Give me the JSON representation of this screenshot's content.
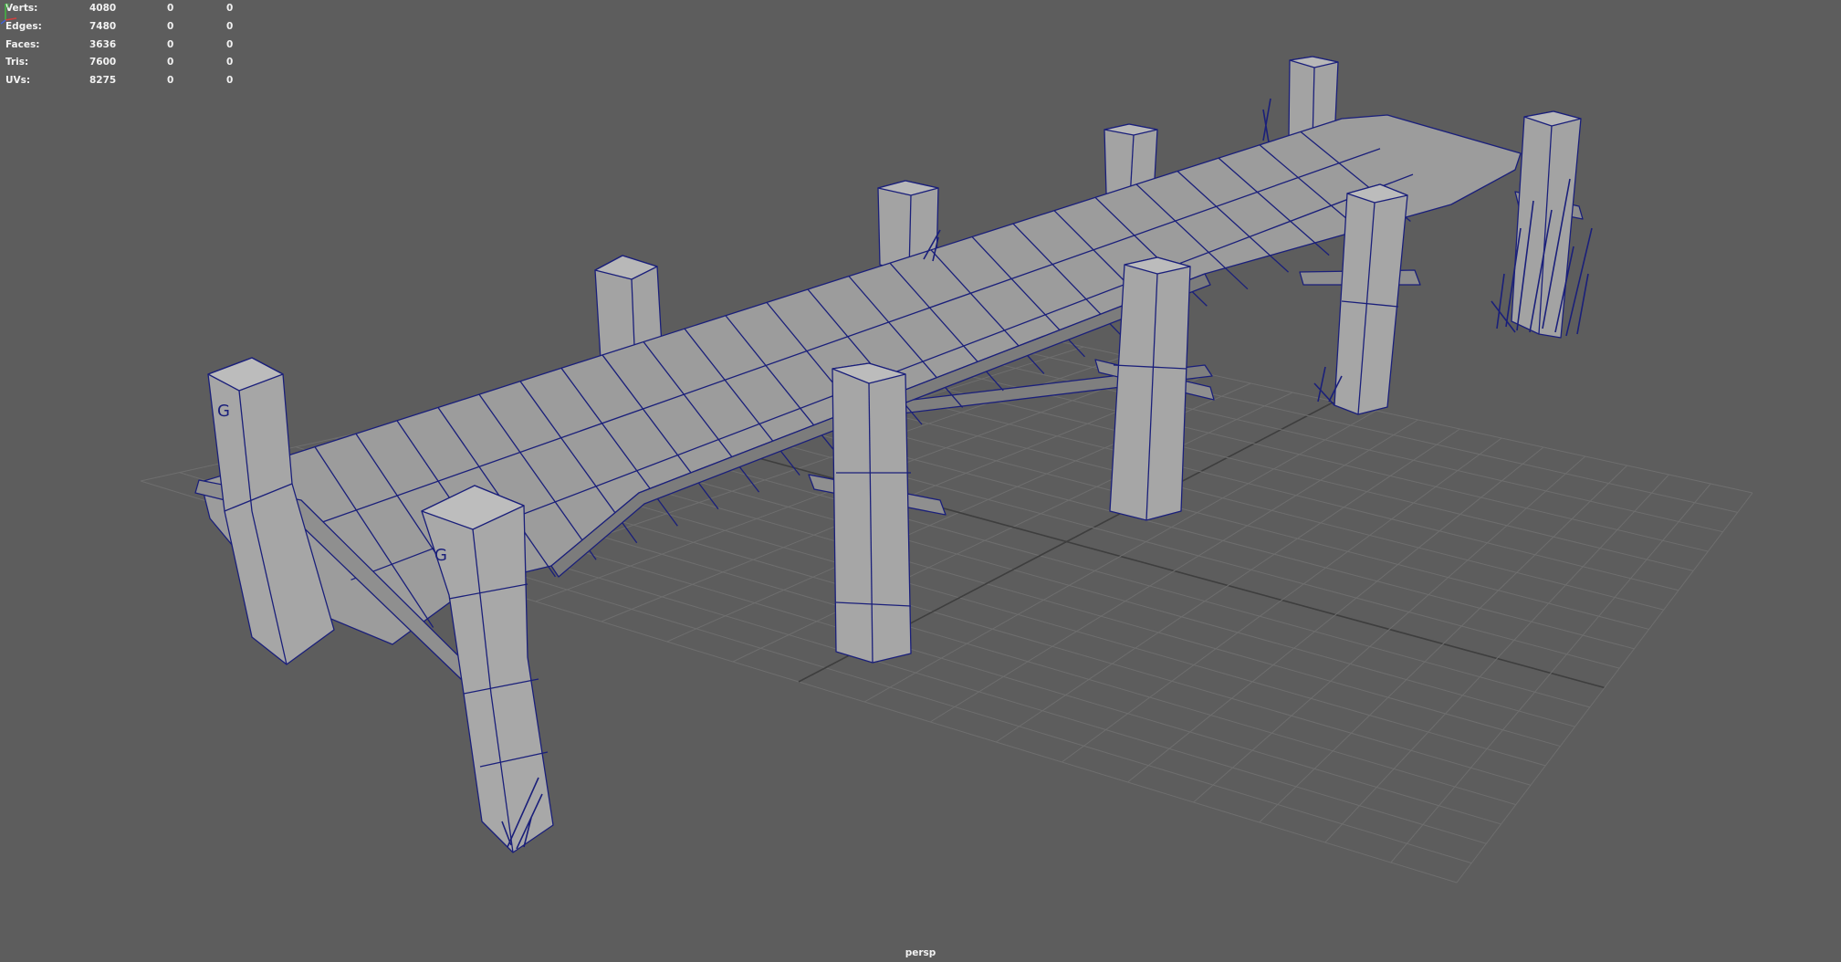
{
  "viewport": {
    "camera_name": "persp",
    "grid": true,
    "colors": {
      "background": "#5d5d5d",
      "grid_line": "#6e6e6e",
      "grid_axis": "#3e3e3e",
      "mesh_face": "#9a9a9a",
      "mesh_wire": "#1a1f7a",
      "hud_text": "#f2f2f2"
    }
  },
  "hud": {
    "rows": [
      {
        "label": "Verts:",
        "v1": "4080",
        "v2": "0",
        "v3": "0"
      },
      {
        "label": "Edges:",
        "v1": "7480",
        "v2": "0",
        "v3": "0"
      },
      {
        "label": "Faces:",
        "v1": "3636",
        "v2": "0",
        "v3": "0"
      },
      {
        "label": "Tris:",
        "v1": "7600",
        "v2": "0",
        "v3": "0"
      },
      {
        "label": "UVs:",
        "v1": "8275",
        "v2": "0",
        "v3": "0"
      }
    ]
  },
  "axis_gizmo": {
    "x_color": "#d04040",
    "y_color": "#40c040",
    "z_color": "#4060e0",
    "icon": "view-axis-icon"
  }
}
